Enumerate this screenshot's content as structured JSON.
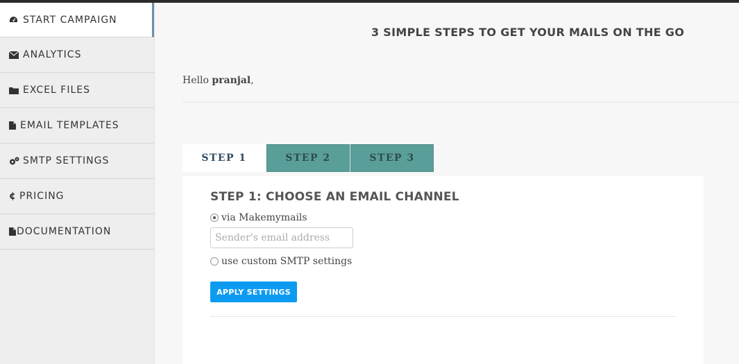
{
  "sidebar": {
    "items": [
      {
        "label": "START CAMPAIGN",
        "icon": "dashboard-icon"
      },
      {
        "label": "ANALYTICS",
        "icon": "envelope-icon"
      },
      {
        "label": "EXCEL FILES",
        "icon": "folder-icon"
      },
      {
        "label": "EMAIL TEMPLATES",
        "icon": "file-icon"
      },
      {
        "label": "SMTP SETTINGS",
        "icon": "gears-icon"
      },
      {
        "label": "PRICING",
        "icon": "cent-icon"
      },
      {
        "label": "DOCUMENTATION",
        "icon": "file-icon"
      }
    ]
  },
  "main": {
    "headline": "3 SIMPLE STEPS TO GET YOUR MAILS ON THE GO",
    "greeting_prefix": "Hello ",
    "username": "pranjal",
    "greeting_suffix": ",",
    "tabs": [
      {
        "label": "STEP 1"
      },
      {
        "label": "STEP 2"
      },
      {
        "label": "STEP 3"
      }
    ],
    "panel": {
      "title": "STEP 1: CHOOSE AN EMAIL CHANNEL",
      "option1": "via Makemymails",
      "email_placeholder": "Sender's email address",
      "option2": "use custom SMTP settings",
      "apply_label": "APPLY SETTINGS"
    }
  },
  "colors": {
    "accent_button": "#0d9bf2",
    "tab_inactive": "#5a9e9a",
    "active_border": "#6b8fb3"
  }
}
